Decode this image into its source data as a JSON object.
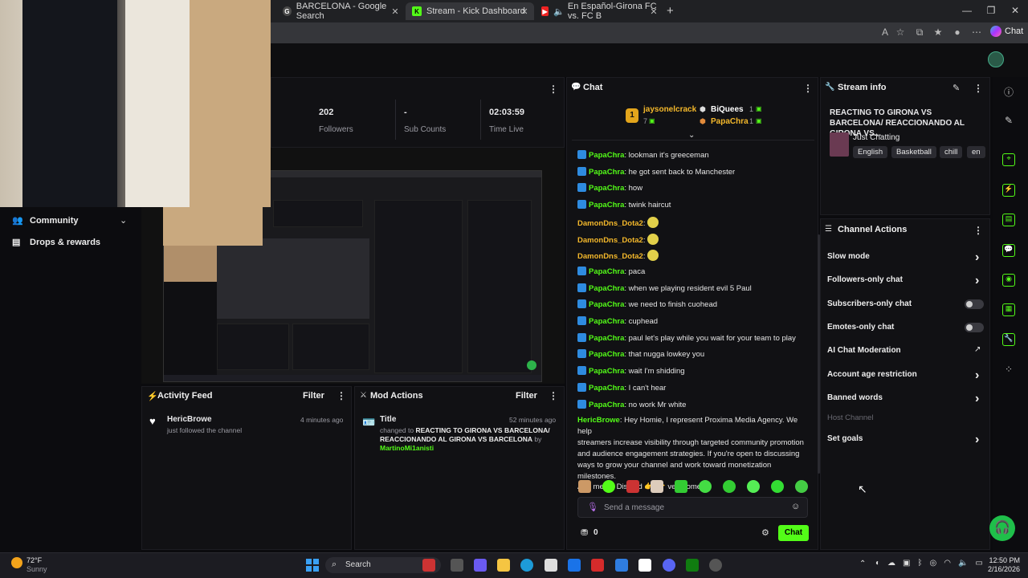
{
  "browser": {
    "tabs": [
      {
        "label": "BARCELONA - Google Search",
        "active": false
      },
      {
        "label": "Stream - Kick Dashboard",
        "active": true
      },
      {
        "label": "En Español-Girona FC vs. FC B",
        "active": false
      }
    ],
    "chat_button": "Chat"
  },
  "stats": {
    "followers_value": "202",
    "followers_label": "Followers",
    "subs_value": "-",
    "subs_label": "Sub Counts",
    "time_value": "02:03:59",
    "time_label": "Time Live"
  },
  "sidebar": {
    "community": "Community",
    "drops": "Drops & rewards"
  },
  "chat": {
    "title": "Chat",
    "leaderboard": {
      "first_name": "jaysonelcrack",
      "first_count": "7",
      "second_name": "BiQuees",
      "second_count": "1",
      "third_name": "PapaChra",
      "third_count": "1"
    },
    "messages": [
      {
        "user": "PapaChra",
        "text": ": lookman it's greeceman"
      },
      {
        "user": "PapaChra",
        "text": ": he got sent back to Manchester"
      },
      {
        "user": "PapaChra",
        "text": ": how"
      },
      {
        "user": "PapaChra",
        "text": ": twink haircut"
      },
      {
        "user": "DamonDns_Dota2",
        "text": ":"
      },
      {
        "user": "DamonDns_Dota2",
        "text": ":"
      },
      {
        "user": "DamonDns_Dota2",
        "text": ":"
      },
      {
        "user": "PapaChra",
        "text": ": paca"
      },
      {
        "user": "PapaChra",
        "text": ": when we playing resident evil 5 Paul"
      },
      {
        "user": "PapaChra",
        "text": ": we need to finish cuohead"
      },
      {
        "user": "PapaChra",
        "text": ": cuphead"
      },
      {
        "user": "PapaChra",
        "text": ": paul let's play while you wait for your team to play"
      },
      {
        "user": "PapaChra",
        "text": ": that nugga lowkey you"
      },
      {
        "user": "PapaChra",
        "text": ": wait I'm shidding"
      },
      {
        "user": "PapaChra",
        "text": ": I can't hear"
      },
      {
        "user": "PapaChra",
        "text": ": no work Mr white"
      }
    ],
    "long_user": "HericBrowe",
    "long_msg_1": ": Hey Homie, I represent Proxima Media Agency. We help",
    "long_msg_2": "streamers increase visibility through targeted community promotion",
    "long_msg_3": "and audience engagement strategies. If you're open to discussing",
    "long_msg_4": "ways to grow your channel and work toward monetization milestones.",
    "long_msg_5": "Add me on Discord 👉 👉  vexprome",
    "input_placeholder": "Send a message",
    "points": "0",
    "send_button": "Chat"
  },
  "stream_info": {
    "title": "Stream info",
    "stream_title": "REACTING TO GIRONA VS BARCELONA/ REACCIONANDO AL GIRONA VS...",
    "category": "Just Chatting",
    "tags": [
      "English",
      "Basketball",
      "chill",
      "en"
    ]
  },
  "channel_actions": {
    "title": "Channel Actions",
    "items": [
      {
        "label": "Slow mode",
        "control": "chevron"
      },
      {
        "label": "Followers-only chat",
        "control": "chevron"
      },
      {
        "label": "Subscribers-only chat",
        "control": "toggle"
      },
      {
        "label": "Emotes-only chat",
        "control": "toggle"
      },
      {
        "label": "AI Chat Moderation",
        "control": "external"
      },
      {
        "label": "Account age restriction",
        "control": "chevron"
      },
      {
        "label": "Banned words",
        "control": "chevron"
      },
      {
        "label": "Host Channel",
        "control": "none"
      },
      {
        "label": "Set goals",
        "control": "chevron"
      }
    ]
  },
  "activity_feed": {
    "title": "Activity Feed",
    "filter": "Filter",
    "event_user": "HericBrowe",
    "event_text": "just followed the channel",
    "event_time": "4 minutes ago"
  },
  "mod_actions": {
    "title": "Mod Actions",
    "filter": "Filter",
    "event_title": "Title",
    "event_time": "52 minutes ago",
    "changed_to": "changed to",
    "new_title": "REACTING TO GIRONA VS BARCELONA/ REACCIONANDO AL GIRONA VS BARCELONA",
    "by": "by",
    "moderator": "MartinoMi1anisti"
  },
  "taskbar": {
    "temp": "72°F",
    "weather": "Sunny",
    "search": "Search",
    "time": "12:50 PM",
    "date": "2/16/2026"
  },
  "colors": {
    "accent": "#53fc18",
    "kick_blue": "#2e8be0",
    "gold": "#f4b82b"
  }
}
